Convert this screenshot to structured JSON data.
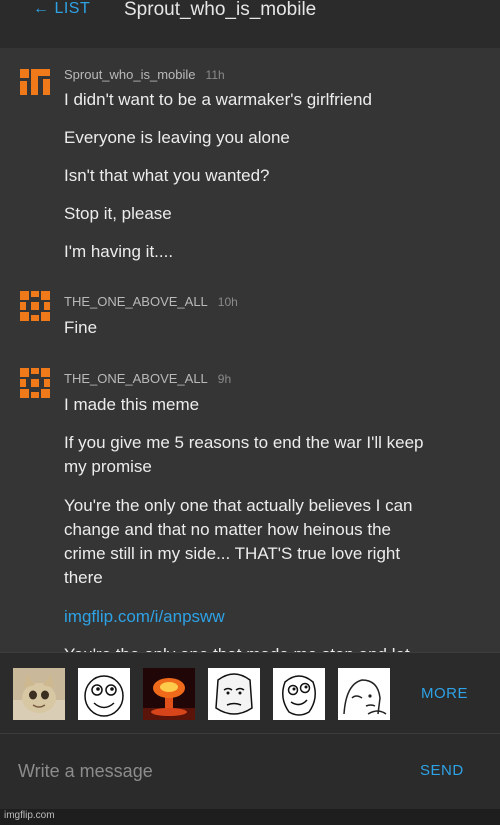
{
  "header": {
    "back_label": "← LIST",
    "title": "Sprout_who_is_mobile"
  },
  "messages": [
    {
      "username": "Sprout_who_is_mobile",
      "time": "11h",
      "avatar_icon": "sprout-logo-icon",
      "lines": [
        "I didn't want to be a warmaker's girlfriend",
        "Everyone is leaving you alone",
        "Isn't that what you wanted?",
        "Stop it, please",
        "I'm having it...."
      ]
    },
    {
      "username": "THE_ONE_ABOVE_ALL",
      "time": "10h",
      "avatar_icon": "orange-block-icon",
      "lines": [
        "Fine"
      ]
    },
    {
      "username": "THE_ONE_ABOVE_ALL",
      "time": "9h",
      "avatar_icon": "orange-block-icon",
      "lines": [
        "I made this meme",
        "If you give me 5 reasons to end the war I'll keep",
        "my promise",
        "You're the only one that actually believes I can",
        "change and that no matter how heinous the",
        "crime still in my side... THAT'S true love right",
        "there",
        "imgflip.com/i/anpsww",
        "You're the only one that made me stop and let"
      ]
    }
  ],
  "meme_tray": {
    "thumbnails": [
      "cat-meme-icon",
      "rage-face-meme-icon",
      "explosion-meme-icon",
      "okay-face-meme-icon",
      "derp-face-meme-icon",
      "wojak-meme-icon"
    ],
    "more_label": "MORE"
  },
  "composer": {
    "placeholder": "Write a message",
    "send_label": "SEND"
  },
  "footer": {
    "watermark": "imgflip.com"
  },
  "colors": {
    "accent": "#2ea2e6",
    "avatar_orange": "#f07a1a",
    "thread_bg": "#353535",
    "chrome_bg": "#2b2b2b"
  }
}
